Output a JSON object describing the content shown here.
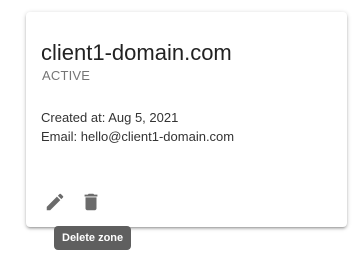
{
  "card": {
    "title": "client1-domain.com",
    "status": "ACTIVE",
    "created": "Created at: Aug 5, 2021",
    "email": "Email: hello@client1-domain.com"
  },
  "actions": {
    "edit_icon": "pencil-icon",
    "delete_icon": "trash-icon"
  },
  "tooltip": {
    "text": "Delete zone"
  },
  "colors": {
    "icon": "#6b6b6b",
    "tooltip_bg": "#5f5f5f",
    "status_text": "#757575"
  }
}
